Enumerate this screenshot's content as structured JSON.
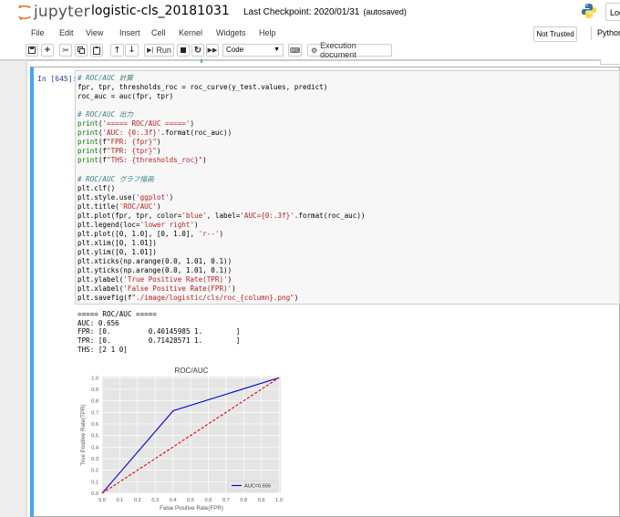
{
  "header": {
    "logo_text": "jupyter",
    "notebook_name": "logistic-cls_20181031",
    "checkpoint": "Last Checkpoint: 2020/01/31",
    "autosave": "(autosaved)",
    "logout_label": "Log"
  },
  "menu": [
    "File",
    "Edit",
    "View",
    "Insert",
    "Cell",
    "Kernel",
    "Widgets",
    "Help"
  ],
  "trusted_label": "Not Trusted",
  "kernel_label": "Python",
  "toolbar": {
    "run_label": "Run",
    "cell_type": "Code",
    "exec_doc_label": "Execution document"
  },
  "cell": {
    "prompt": "In [645]:",
    "code_lines": [
      [
        {
          "t": "# ROC/AUC 計算",
          "c": "comment"
        }
      ],
      [
        {
          "t": "fpr, tpr, thresholds_roc = roc_curve(y_test.values, predict)"
        }
      ],
      [
        {
          "t": "roc_auc = auc(fpr, tpr)"
        }
      ],
      [
        {
          "t": ""
        }
      ],
      [
        {
          "t": "# ROC/AUC 出力",
          "c": "comment"
        }
      ],
      [
        {
          "t": "print",
          "c": "kw"
        },
        {
          "t": "("
        },
        {
          "t": "'===== ROC/AUC ====='",
          "c": "string"
        },
        {
          "t": ")"
        }
      ],
      [
        {
          "t": "print",
          "c": "kw"
        },
        {
          "t": "("
        },
        {
          "t": "'AUC: {0:.3f}'",
          "c": "string"
        },
        {
          "t": ".format(roc_auc))"
        }
      ],
      [
        {
          "t": "print",
          "c": "kw"
        },
        {
          "t": "(f"
        },
        {
          "t": "\"FPR: {fpr}\"",
          "c": "string"
        },
        {
          "t": ")"
        }
      ],
      [
        {
          "t": "print",
          "c": "kw"
        },
        {
          "t": "(f"
        },
        {
          "t": "\"TPR: {tpr}\"",
          "c": "string"
        },
        {
          "t": ")"
        }
      ],
      [
        {
          "t": "print",
          "c": "kw"
        },
        {
          "t": "(f"
        },
        {
          "t": "\"THS: {thresholds_roc}\"",
          "c": "string"
        },
        {
          "t": ")"
        }
      ],
      [
        {
          "t": ""
        }
      ],
      [
        {
          "t": "# ROC/AUC グラフ描画",
          "c": "comment"
        }
      ],
      [
        {
          "t": "plt.clf()"
        }
      ],
      [
        {
          "t": "plt.style.use("
        },
        {
          "t": "'ggplot'",
          "c": "string"
        },
        {
          "t": ")"
        }
      ],
      [
        {
          "t": "plt.title("
        },
        {
          "t": "'ROC/AUC'",
          "c": "string"
        },
        {
          "t": ")"
        }
      ],
      [
        {
          "t": "plt.plot(fpr, tpr, color="
        },
        {
          "t": "'blue'",
          "c": "string"
        },
        {
          "t": ", label="
        },
        {
          "t": "'AUC={0:.3f}'",
          "c": "string"
        },
        {
          "t": ".format(roc_auc))"
        }
      ],
      [
        {
          "t": "plt.legend(loc="
        },
        {
          "t": "'lower right'",
          "c": "string"
        },
        {
          "t": ")"
        }
      ],
      [
        {
          "t": "plt.plot([0, 1.0], [0, 1.0], "
        },
        {
          "t": "'r--'",
          "c": "string"
        },
        {
          "t": ")"
        }
      ],
      [
        {
          "t": "plt.xlim([0, 1.01])"
        }
      ],
      [
        {
          "t": "plt.ylim([0, 1.01])"
        }
      ],
      [
        {
          "t": "plt.xticks(np.arange(0.0, 1.01, 0.1))"
        }
      ],
      [
        {
          "t": "plt.yticks(np.arange(0.0, 1.01, 0.1))"
        }
      ],
      [
        {
          "t": "plt.ylabel("
        },
        {
          "t": "'True Positive Rate(TPR)'",
          "c": "string"
        },
        {
          "t": ")"
        }
      ],
      [
        {
          "t": "plt.xlabel("
        },
        {
          "t": "'False Positive Rate(FPR)'",
          "c": "string"
        },
        {
          "t": ")"
        }
      ],
      [
        {
          "t": "plt.savefig(f"
        },
        {
          "t": "\"./image/logistic/cls/roc_{column}.png\"",
          "c": "string"
        },
        {
          "t": ")"
        }
      ]
    ],
    "output_lines": [
      "===== ROC/AUC =====",
      "AUC: 0.656",
      "FPR: [0.         0.40145985 1.        ]",
      "TPR: [0.         0.71428571 1.        ]",
      "THS: [2 1 0]"
    ]
  },
  "chart_data": {
    "type": "line",
    "title": "ROC/AUC",
    "xlabel": "False Positive Rate(FPR)",
    "ylabel": "True Positive Rate(TPR)",
    "xlim": [
      0,
      1.01
    ],
    "ylim": [
      0,
      1.01
    ],
    "xticks": [
      "0.0",
      "0.1",
      "0.2",
      "0.3",
      "0.4",
      "0.5",
      "0.6",
      "0.7",
      "0.8",
      "0.9",
      "1.0"
    ],
    "yticks": [
      "0.0",
      "0.1",
      "0.2",
      "0.3",
      "0.4",
      "0.5",
      "0.6",
      "0.7",
      "0.8",
      "0.9",
      "1.0"
    ],
    "grid": true,
    "legend_position": "lower right",
    "series": [
      {
        "name": "AUC=0.656",
        "color": "#0000cc",
        "style": "solid",
        "x": [
          0.0,
          0.40145985,
          1.0
        ],
        "y": [
          0.0,
          0.71428571,
          1.0
        ]
      },
      {
        "color": "#e00000",
        "style": "dashed",
        "x": [
          0.0,
          1.0
        ],
        "y": [
          0.0,
          1.0
        ]
      }
    ]
  }
}
